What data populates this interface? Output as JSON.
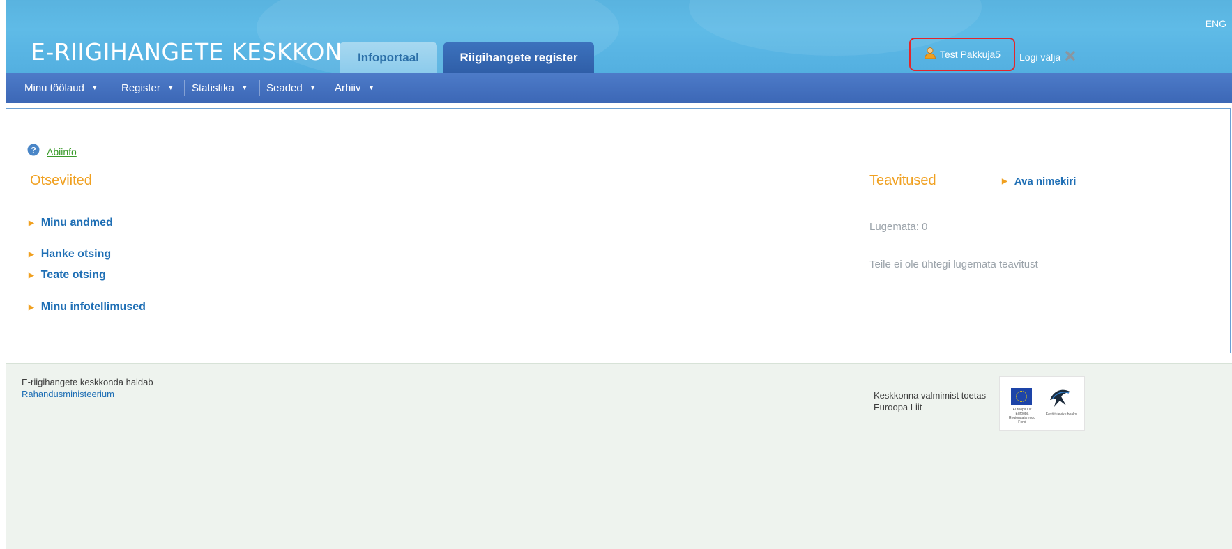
{
  "header": {
    "site_title": "E-RIIGIHANGETE KESKKOND",
    "tabs": [
      {
        "label": "Infoportaal",
        "active": false
      },
      {
        "label": "Riigihangete register",
        "active": true
      }
    ],
    "language_switch": "ENG",
    "user": {
      "name": "Test Pakkuja5",
      "icon": "user-icon",
      "highlight_color": "#e2262b"
    },
    "logout": {
      "label": "Logi välja",
      "icon": "close-x-icon"
    }
  },
  "nav": {
    "items": [
      {
        "label": "Minu töölaud",
        "icon": "chevron-down-icon"
      },
      {
        "label": "Register",
        "icon": "chevron-down-icon"
      },
      {
        "label": "Statistika",
        "icon": "chevron-down-icon"
      },
      {
        "label": "Seaded",
        "icon": "chevron-down-icon"
      },
      {
        "label": "Arhiiv",
        "icon": "chevron-down-icon"
      }
    ]
  },
  "help": {
    "label": "Abiinfo",
    "icon": "help-icon"
  },
  "shortcuts": {
    "title": "Otseviited",
    "links": [
      "Minu andmed",
      "Hanke otsing",
      "Teate otsing",
      "Minu infotellimused"
    ]
  },
  "notifications": {
    "title": "Teavitused",
    "open_list_label": "Ava nimekiri",
    "unread_label": "Lugemata: 0",
    "empty_message": "Teile ei ole ühtegi lugemata teavitust"
  },
  "footer": {
    "managed_by_text": "E-riigihangete keskkonda haldab",
    "managed_by_link": "Rahandusministeerium",
    "support_line1": "Keskkonna valmimist toetas",
    "support_line2": "Euroopa Liit",
    "logo_captions": {
      "eu": "Euroopa Liit Euroopa Regionaalarengu Fond",
      "partner": "Eesti tuleviku heaks"
    }
  },
  "colors": {
    "header_blue": "#5ab4e0",
    "nav_blue": "#4570bf",
    "accent_orange": "#f0a020",
    "link_blue": "#1f6fb5",
    "help_green": "#3a9b2a"
  }
}
